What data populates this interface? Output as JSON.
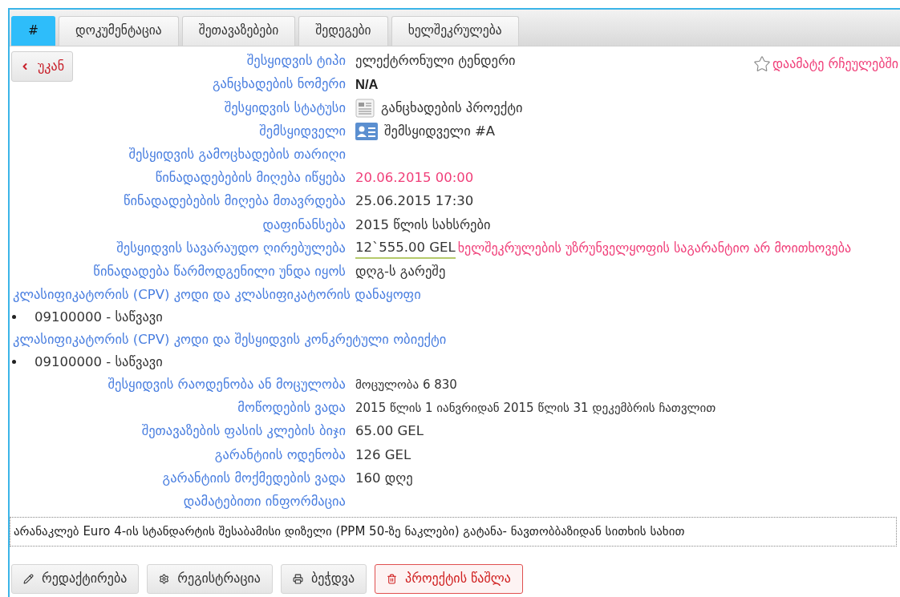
{
  "tabs": [
    {
      "label": "#",
      "selected": true
    },
    {
      "label": "დოკუმენტაცია",
      "selected": false
    },
    {
      "label": "შეთავაზებები",
      "selected": false
    },
    {
      "label": "შედეგები",
      "selected": false
    },
    {
      "label": "ხელშეკრულება",
      "selected": false
    }
  ],
  "back_button": "უკან",
  "favorite_link": "დაამატე რჩეულებში",
  "fields": [
    {
      "kind": "plain",
      "label": "შესყიდვის ტიპი",
      "value": "ელექტრონული ტენდერი"
    },
    {
      "kind": "strong",
      "label": "განცხადების ნომერი",
      "value": "N/A"
    },
    {
      "kind": "status",
      "label": "შესყიდვის სტატუსი",
      "value": "განცხადების პროექტი"
    },
    {
      "kind": "buyer",
      "label": "შემსყიდველი",
      "value": "შემსყიდველი #A"
    },
    {
      "kind": "plain",
      "label": "შესყიდვის გამოცხადების თარიღი"
    },
    {
      "kind": "alert",
      "label": "წინადადებების მიღება იწყება",
      "value": "20.06.2015 00:00"
    },
    {
      "kind": "plain",
      "label": "წინადადებების მიღება მთავრდება",
      "value": "25.06.2015 17:30"
    },
    {
      "kind": "plain",
      "label": "დაფინანსება",
      "value": "2015 წლის სახსრები"
    },
    {
      "kind": "amount",
      "label": "შესყიდვის სავარაუდო ღირებულება",
      "value": "12`555.00 GEL",
      "note": "ხელშეკრულების უზრუნველყოფის საგარანტიო არ მოითხოვება"
    },
    {
      "kind": "plain",
      "label": "წინადადება წარმოდგენილი უნდა იყოს",
      "value": "დღგ-ს გარეშე"
    },
    {
      "kind": "section",
      "label": "კლასიფიკატორის (CPV) კოდი და კლასიფიკატორის დანაყოფი"
    },
    {
      "kind": "bullet",
      "label": "09100000 - საწვავი"
    },
    {
      "kind": "section",
      "label": "კლასიფიკატორის (CPV) კოდი და შესყიდვის კონკრეტული ობიექტი"
    },
    {
      "kind": "bullet",
      "label": "09100000 - საწვავი"
    },
    {
      "kind": "small",
      "label": "შესყიდვის რაოდენობა ან მოცულობა",
      "value": "მოცულობა 6 830"
    },
    {
      "kind": "small",
      "label": "მოწოდების ვადა",
      "value": "2015 წლის 1 იანვრიდან 2015 წლის 31 დეკემბრის ჩათვლით"
    },
    {
      "kind": "plain",
      "label": "შეთავაზების ფასის კლების ბიჯი",
      "value": "65.00 GEL"
    },
    {
      "kind": "plain",
      "label": "გარანტიის ოდენობა",
      "value": "126 GEL"
    },
    {
      "kind": "plain",
      "label": "გარანტიის მოქმედების ვადა",
      "value": "160 დღე"
    },
    {
      "kind": "plain",
      "label": "დამატებითი ინფორმაცია"
    }
  ],
  "description": "არანაკლებ Euro 4-ის სტანდარტის შესაბამისი დიზელი (PPM 50-ზე ნაკლები) გატანა- ნავთობბაზიდან სითხის სახით",
  "actions": [
    {
      "label": "რედაქტირება",
      "kind": "edit"
    },
    {
      "label": "რეგისტრაცია",
      "kind": "register"
    },
    {
      "label": "ბეჭდვა",
      "kind": "print"
    },
    {
      "label": "პროექტის წაშლა",
      "kind": "delete"
    }
  ]
}
